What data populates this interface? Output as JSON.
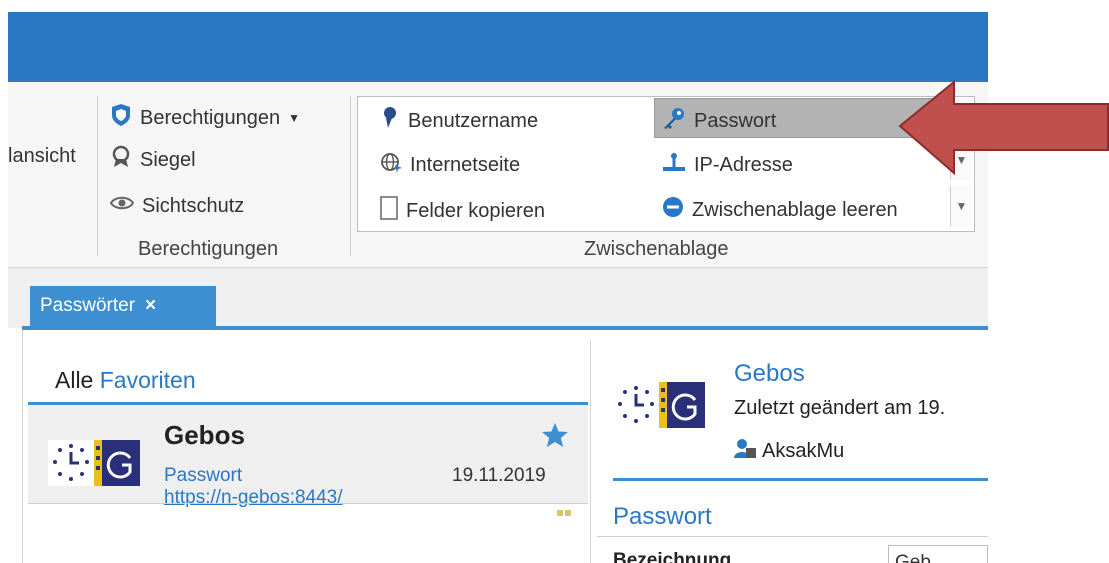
{
  "ribbon": {
    "left_partial": "lansicht",
    "berechtigungen_items": [
      {
        "label": "Berechtigungen",
        "icon": "shield-icon",
        "dropdown": true
      },
      {
        "label": "Siegel",
        "icon": "seal-icon"
      },
      {
        "label": "Sichtschutz",
        "icon": "eye-icon"
      }
    ],
    "berechtigungen_group": "Berechtigungen",
    "clipboard_items": [
      {
        "label": "Benutzername",
        "icon": "user-icon"
      },
      {
        "label": "Passwort",
        "icon": "key-icon"
      },
      {
        "label": "Internetseite",
        "icon": "globe-icon"
      },
      {
        "label": "IP-Adresse",
        "icon": "network-icon"
      },
      {
        "label": "Felder kopieren",
        "icon": "document-icon"
      },
      {
        "label": "Zwischenablage leeren",
        "icon": "clear-icon"
      }
    ],
    "clipboard_group": "Zwischenablage"
  },
  "tabs": [
    {
      "label": "Passwörter",
      "close": "×"
    }
  ],
  "list": {
    "header_prefix": "Alle",
    "header_filter": "Favoriten",
    "items": [
      {
        "title": "Gebos",
        "type": "Passwort",
        "date": "19.11.2019",
        "url": "https://n-gebos:8443/"
      }
    ]
  },
  "detail": {
    "title": "Gebos",
    "changed": "Zuletzt geändert am 19.",
    "user": "AksakMu",
    "section": "Passwort",
    "field_label_partial": "Bezeichnung",
    "field_value_partial": "Geb"
  },
  "colors": {
    "accent": "#2a78c3",
    "tab": "#3d8fd1",
    "arrow": "#c0504d",
    "highlight": "#b3b3b3"
  }
}
